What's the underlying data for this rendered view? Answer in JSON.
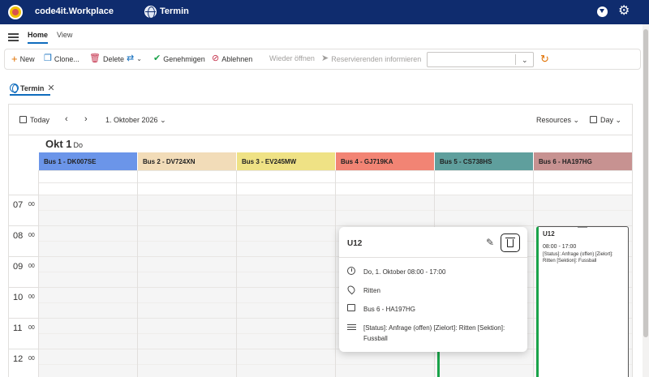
{
  "header": {
    "app_title": "code4it.Workplace",
    "page_title": "Termin",
    "bar_color": "#0f2c6e"
  },
  "menu": {
    "tabs": [
      {
        "label": "Home",
        "active": true
      },
      {
        "label": "View",
        "active": false
      }
    ]
  },
  "toolbar": {
    "new_label": "New",
    "clone_label": "Clone...",
    "delete_label": "Delete",
    "approve_label": "Genehmigen",
    "reject_label": "Ablehnen",
    "reopen_label": "Wieder öffnen",
    "notify_label": "Reservierenden informieren",
    "select_value": ""
  },
  "doc_tab": {
    "label": "Termin"
  },
  "calendar": {
    "today_label": "Today",
    "date_label": "1. Oktober 2026",
    "resources_label": "Resources",
    "view_label": "Day",
    "day_heading": "Okt 1",
    "day_of_week": "Do",
    "resources": [
      {
        "label": "Bus 1 - DK007SE",
        "color": "#6b95e9"
      },
      {
        "label": "Bus 2 - DV724XN",
        "color": "#f2dcb8"
      },
      {
        "label": "Bus 3 - EV245MW",
        "color": "#efe285"
      },
      {
        "label": "Bus 4 - GJ719KA",
        "color": "#f28474"
      },
      {
        "label": "Bus 5 - CS738HS",
        "color": "#5f9f9d"
      },
      {
        "label": "Bus 6 - HA197HG",
        "color": "#c79291"
      }
    ],
    "hours": [
      {
        "hour": "07",
        "min": "00"
      },
      {
        "hour": "08",
        "min": "00"
      },
      {
        "hour": "09",
        "min": "00"
      },
      {
        "hour": "10",
        "min": "00"
      },
      {
        "hour": "11",
        "min": "00"
      },
      {
        "hour": "12",
        "min": "00"
      }
    ]
  },
  "event": {
    "title": "U12",
    "time": "08:00 - 17:00",
    "description": "[Status]: Anfrage (offen) [Zielort]: Ritten [Sektion]: Fussball"
  },
  "popup": {
    "title": "U12",
    "datetime": "Do, 1. Oktober 08:00 - 17:00",
    "location": "Ritten",
    "resource": "Bus 6 - HA197HG",
    "description": "[Status]: Anfrage (offen) [Zielort]: Ritten [Sektion]: Fussball"
  }
}
